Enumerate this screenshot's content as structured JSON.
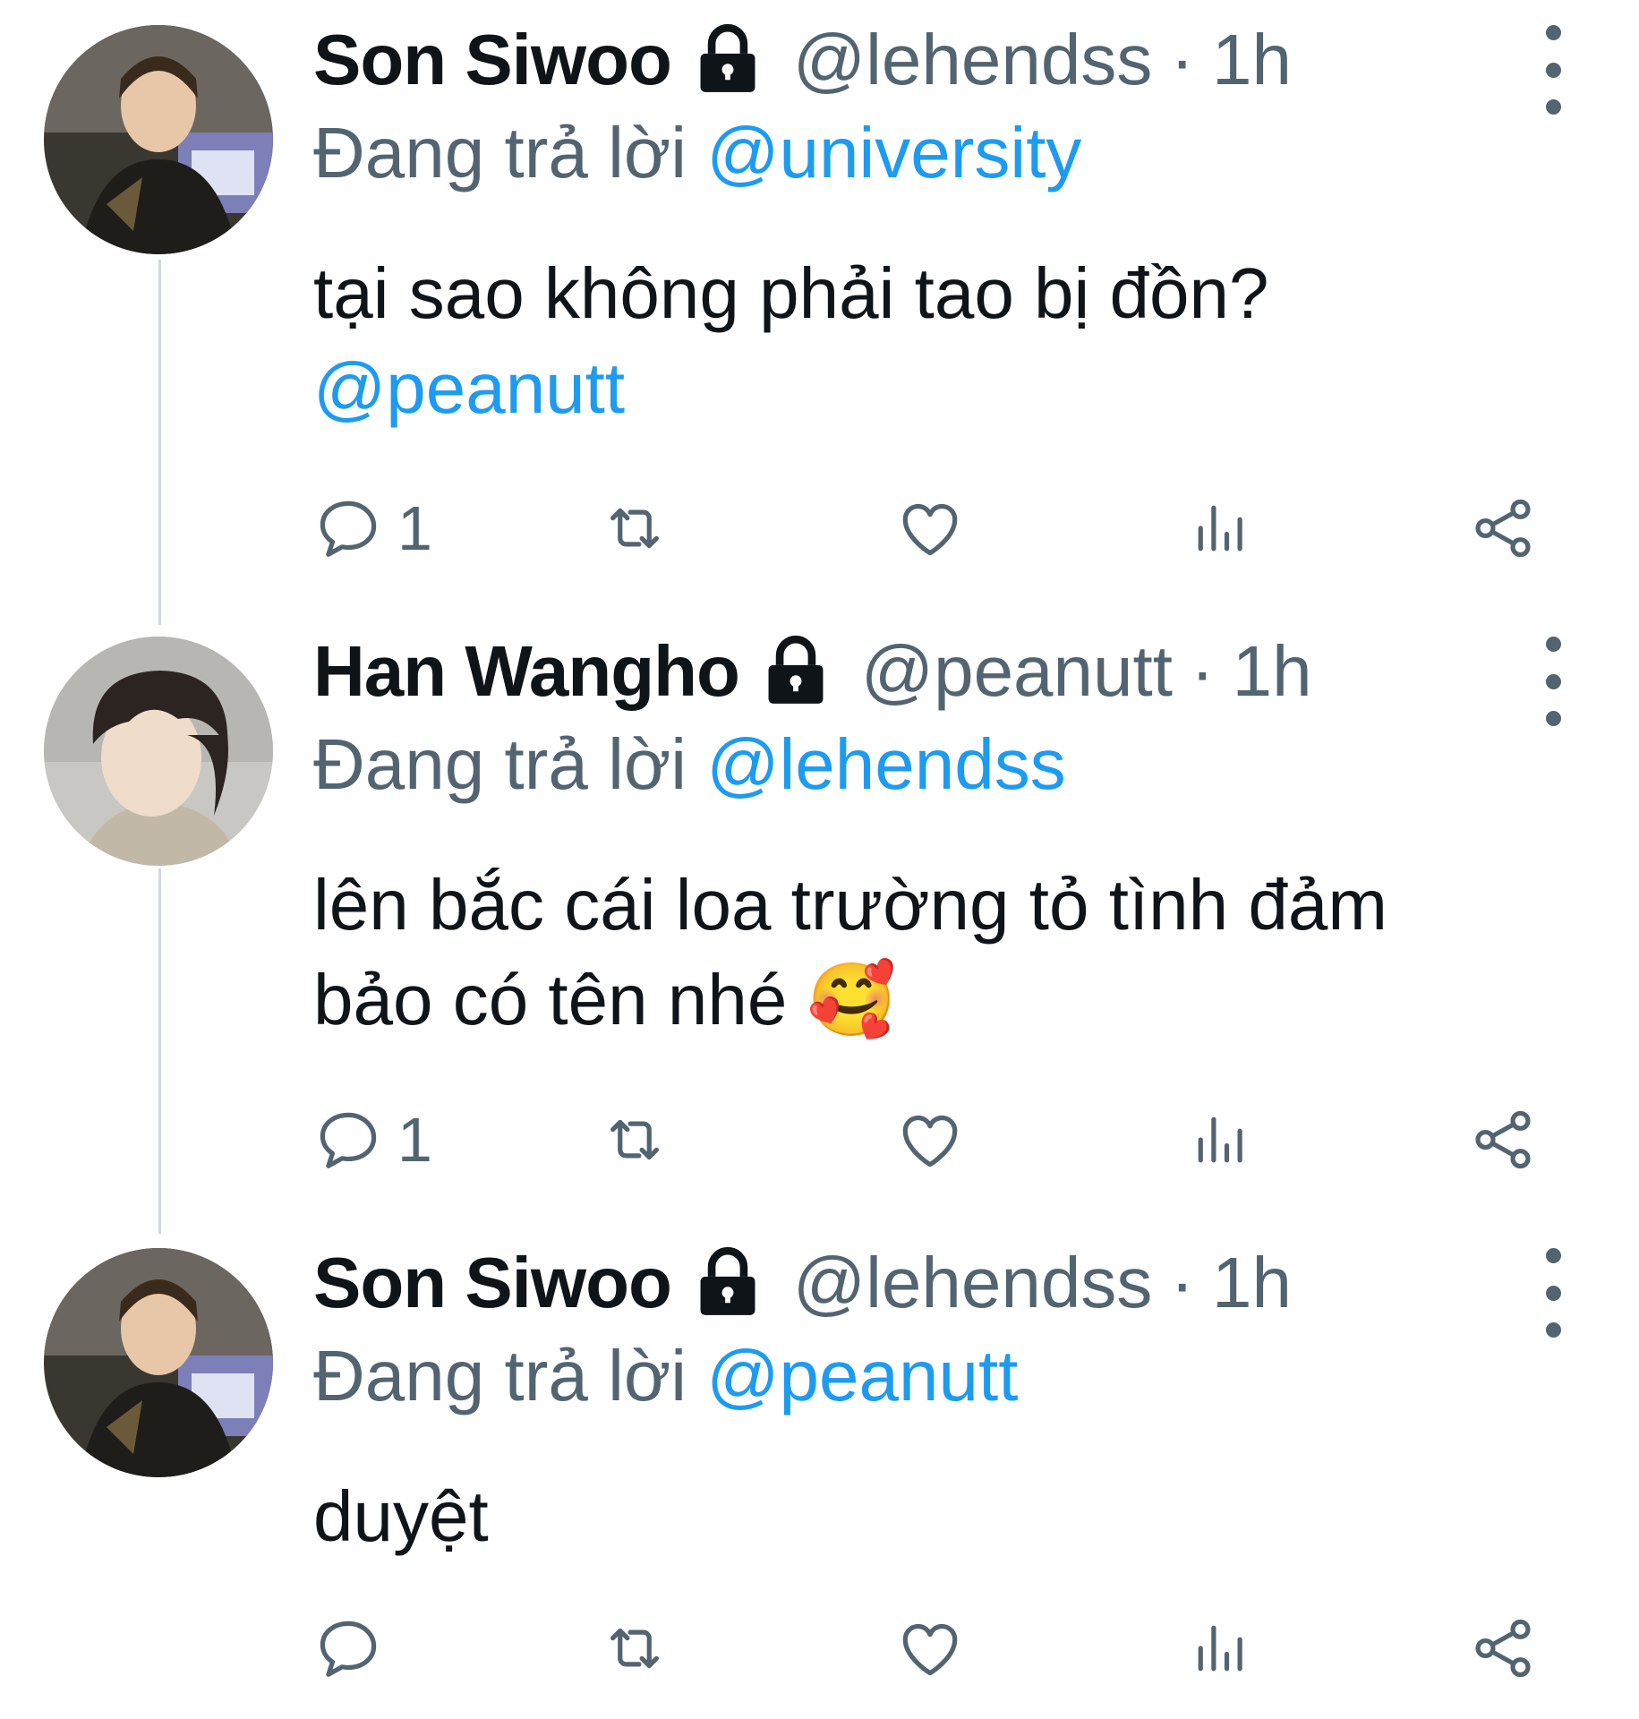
{
  "tweets": [
    {
      "name": "Son Siwoo",
      "handle": "@lehendss",
      "separator": "·",
      "time": "1h",
      "replying_label": "Đang trả lời",
      "replying_to": "@university",
      "text_lines": [
        "tại sao không phải tao bị đồn?"
      ],
      "text_mention": "@peanutt",
      "actions": {
        "reply_count": "1",
        "retweet_count": "",
        "like_count": "",
        "view_count": ""
      },
      "protected": true,
      "avatar": "avatar-son-siwoo"
    },
    {
      "name": "Han Wangho",
      "handle": "@peanutt",
      "separator": "·",
      "time": "1h",
      "replying_label": "Đang trả lời",
      "replying_to": "@lehendss",
      "text_lines": [
        "lên bắc cái loa trường tỏ tình đảm",
        "bảo có tên nhé 🥰"
      ],
      "actions": {
        "reply_count": "1",
        "retweet_count": "",
        "like_count": "",
        "view_count": ""
      },
      "protected": true,
      "avatar": "avatar-han-wangho"
    },
    {
      "name": "Son Siwoo",
      "handle": "@lehendss",
      "separator": "·",
      "time": "1h",
      "replying_label": "Đang trả lời",
      "replying_to": "@peanutt",
      "text_lines": [
        "duyệt"
      ],
      "actions": {
        "reply_count": "",
        "retweet_count": "",
        "like_count": "",
        "view_count": ""
      },
      "protected": true,
      "avatar": "avatar-son-siwoo"
    }
  ],
  "colors": {
    "text": "#0f1419",
    "muted": "#536471",
    "link": "#1d9bf0",
    "thread_line": "#cfd9de"
  },
  "icons": [
    "lock-icon",
    "more-icon",
    "reply-icon",
    "retweet-icon",
    "like-icon",
    "views-icon",
    "share-icon"
  ]
}
